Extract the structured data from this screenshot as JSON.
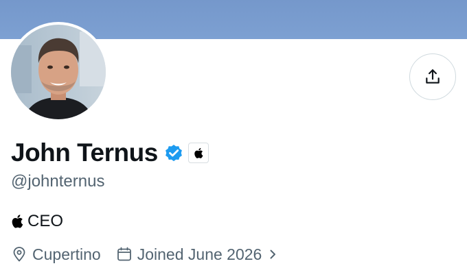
{
  "profile": {
    "display_name": "John Ternus",
    "handle": "@johnternus",
    "verified_badge": "verified-badge-icon",
    "affiliate_badge": "apple-logo-icon",
    "bio": {
      "icon": "apple-logo-icon",
      "text": "CEO"
    },
    "location": "Cupertino",
    "joined": "Joined June 2026"
  },
  "actions": {
    "share_icon": "share-icon"
  },
  "colors": {
    "banner": "#7a9dcf",
    "text_primary": "#0f1419",
    "text_secondary": "#536471",
    "verified_blue": "#1d9bf0",
    "border": "#cfd9de"
  }
}
